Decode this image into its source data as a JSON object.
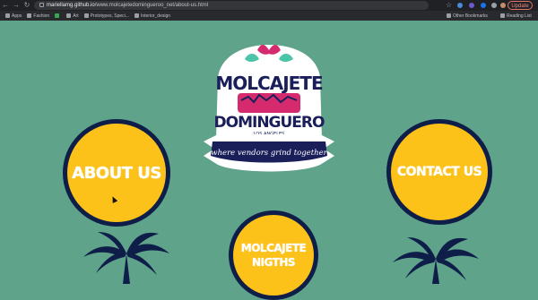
{
  "browser": {
    "url_host": "mariellamg.github.io",
    "url_path": "/www.molcajetedomingueroo_net/about-us.html",
    "update_label": "Update",
    "bookmarks": [
      "Apps",
      "Fashion",
      "Art",
      "Prototypes, Speci...",
      "Interior_design"
    ],
    "other_bookmarks": "Other Bookmarks",
    "reading_list": "Reading List"
  },
  "logo": {
    "line1": "MOLCAJETE",
    "line2": "DOMINGUERO",
    "city": "LOS ANGELES",
    "tagline": "where vendors grind together"
  },
  "nav": {
    "about": "ABOUT US",
    "contact": "CONTACT US",
    "nights_line1": "MOLCAJETE",
    "nights_line2": "NIGTHS"
  },
  "colors": {
    "background": "#5fa38a",
    "circle_fill": "#fcc219",
    "circle_border": "#0f1e48",
    "logo_pink": "#d62a6e",
    "logo_navy": "#1a1f5a"
  }
}
